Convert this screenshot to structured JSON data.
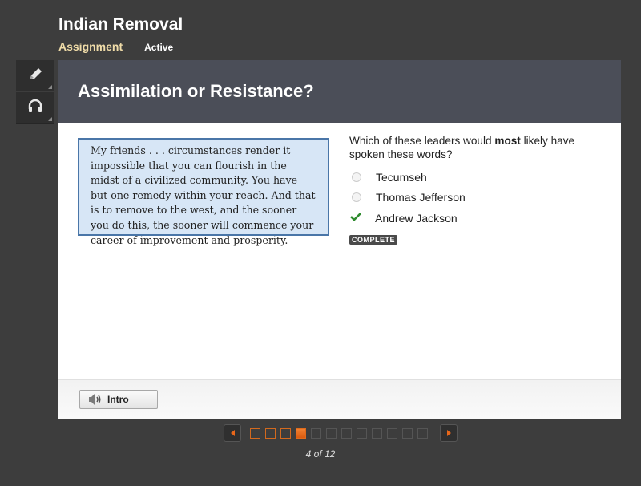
{
  "header": {
    "title": "Indian Removal",
    "section_label": "Assignment",
    "status": "Active"
  },
  "toolrail": {
    "items": [
      {
        "name": "pencil-icon"
      },
      {
        "name": "headphones-icon"
      }
    ]
  },
  "panel": {
    "title": "Assimilation or Resistance?",
    "quote": "My friends . . . circumstances render it impossible that you can flourish in the midst of a civilized community. You have but one remedy within your reach. And that is to remove to the west, and the sooner you do this, the sooner will commence your career of improvement and prosperity.",
    "question": {
      "prefix": "Which of these leaders would ",
      "emphasis": "most",
      "suffix": " likely have spoken these words?"
    },
    "options": [
      {
        "label": "Tecumseh",
        "selected": false
      },
      {
        "label": "Thomas Jefferson",
        "selected": false
      },
      {
        "label": "Andrew Jackson",
        "selected": true
      }
    ],
    "badge": "COMPLETE",
    "footer": {
      "intro_label": "Intro"
    }
  },
  "pager": {
    "current": 4,
    "total": 12,
    "label": "4 of 12",
    "accent": "#e8671a"
  }
}
